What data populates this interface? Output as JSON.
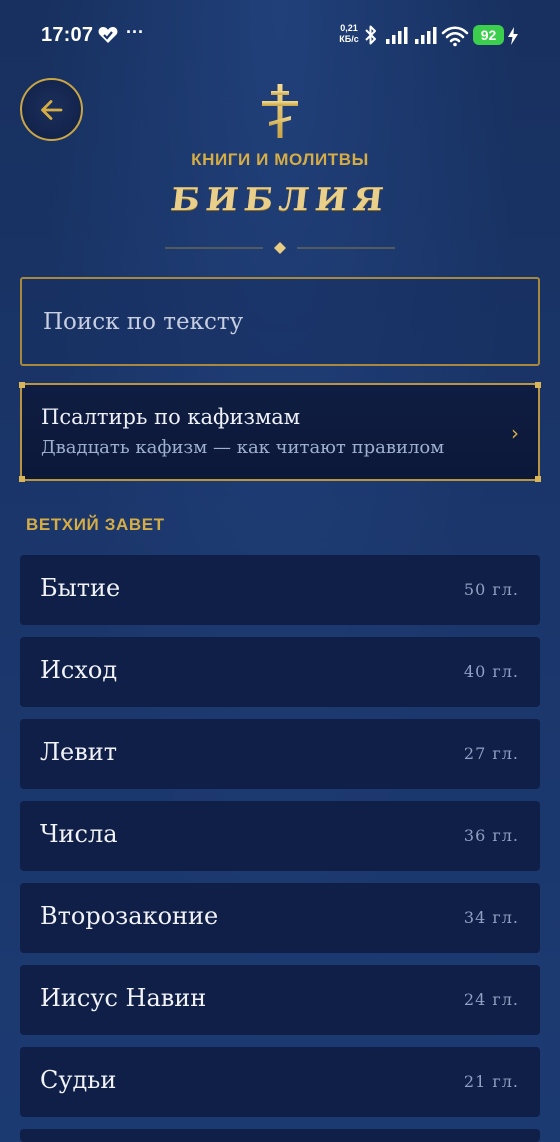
{
  "status_bar": {
    "time": "17:07",
    "notification_icon": "heart-check-icon",
    "more": "···",
    "speed_value": "0,21",
    "speed_unit": "КБ/с",
    "battery": "92"
  },
  "header": {
    "back_icon": "arrow-left-icon",
    "emblem_icon": "orthodox-cross-icon",
    "subtitle": "КНИГИ И МОЛИТВЫ",
    "title": "БИБЛИЯ"
  },
  "search": {
    "placeholder": "Поиск по тексту",
    "value": ""
  },
  "psalter": {
    "title": "Псалтирь по кафизмам",
    "subtitle": "Двадцать кафизм — как читают правилом",
    "chevron": "›"
  },
  "section": {
    "label": "ВЕТХИЙ ЗАВЕТ"
  },
  "books": [
    {
      "name": "Бытие",
      "chapters": "50 гл."
    },
    {
      "name": "Исход",
      "chapters": "40 гл."
    },
    {
      "name": "Левит",
      "chapters": "27 гл."
    },
    {
      "name": "Числа",
      "chapters": "36 гл."
    },
    {
      "name": "Второзаконие",
      "chapters": "34 гл."
    },
    {
      "name": "Иисус Навин",
      "chapters": "24 гл."
    },
    {
      "name": "Судьи",
      "chapters": "21 гл."
    },
    {
      "name": "",
      "chapters": ""
    }
  ],
  "colors": {
    "background": "#1a3468",
    "gold": "#d6ad45",
    "row": "#0f1f47",
    "battery": "#3ccf4e"
  }
}
